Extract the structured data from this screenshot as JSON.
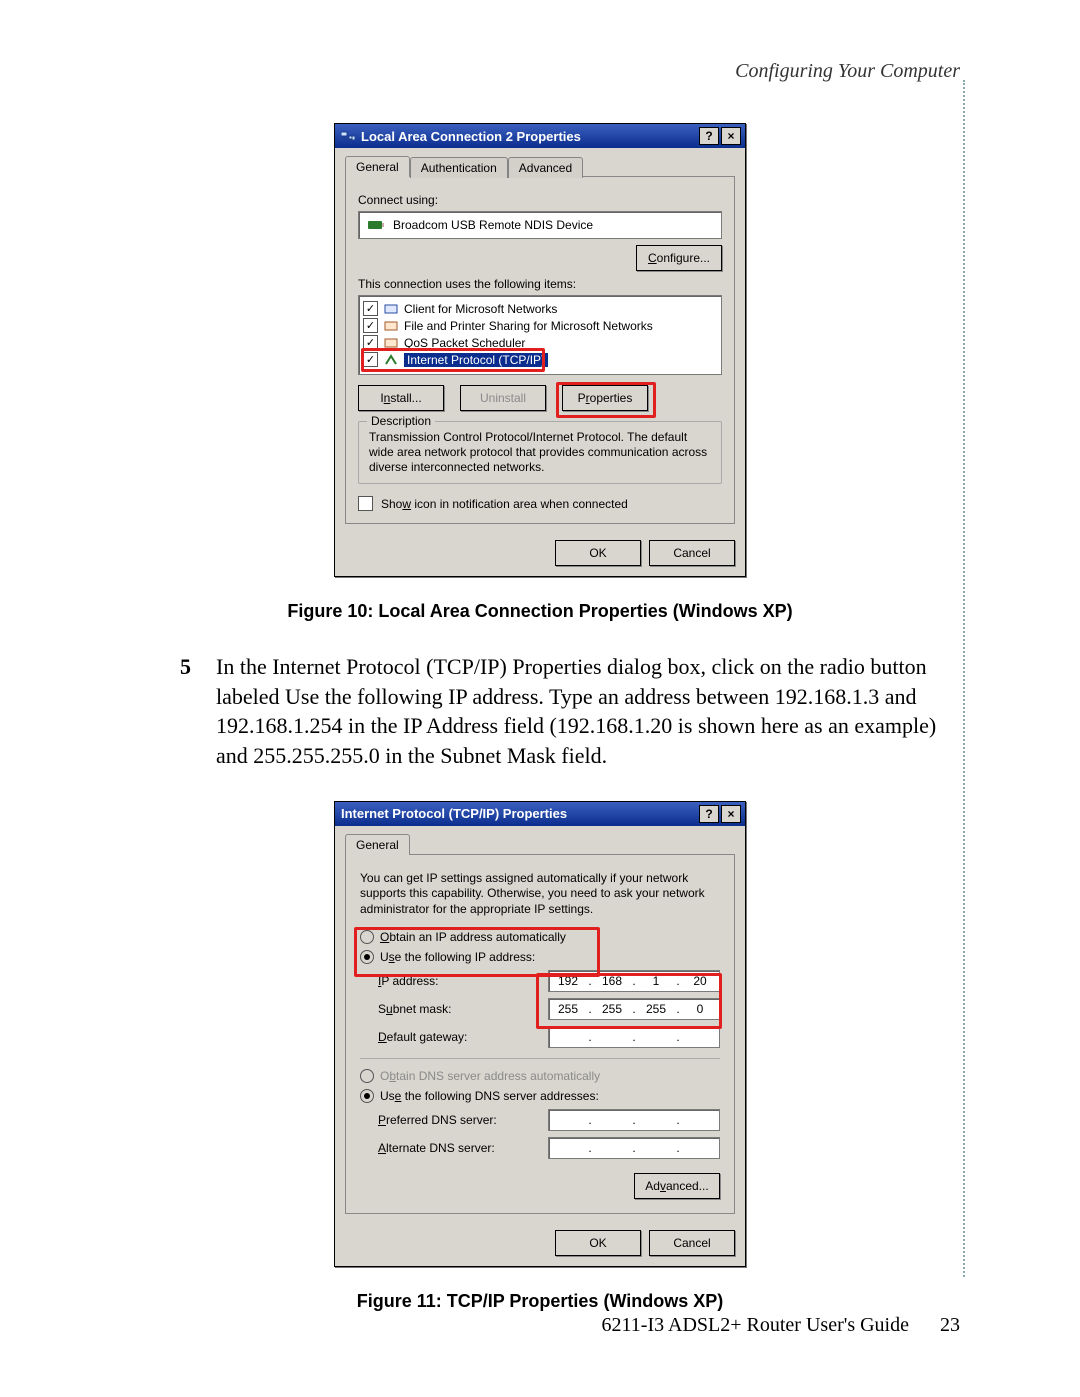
{
  "header": {
    "section": "Configuring Your Computer"
  },
  "figure1": {
    "title": "Local Area Connection 2 Properties",
    "tabs": [
      "General",
      "Authentication",
      "Advanced"
    ],
    "connect_using_label": "Connect using:",
    "device": "Broadcom USB Remote NDIS Device",
    "configure_btn": "Configure...",
    "items_label": "This connection uses the following items:",
    "items": [
      {
        "checked": true,
        "label": "Client for Microsoft Networks"
      },
      {
        "checked": true,
        "label": "File and Printer Sharing for Microsoft Networks"
      },
      {
        "checked": true,
        "label": "QoS Packet Scheduler"
      },
      {
        "checked": true,
        "label": "Internet Protocol (TCP/IP)",
        "selected": true
      }
    ],
    "install_btn": "Install...",
    "uninstall_btn": "Uninstall",
    "properties_btn": "Properties",
    "desc_label": "Description",
    "desc_text": "Transmission Control Protocol/Internet Protocol. The default wide area network protocol that provides communication across diverse interconnected networks.",
    "show_icon": "Show icon in notification area when connected",
    "ok": "OK",
    "cancel": "Cancel",
    "caption": "Figure 10: Local Area Connection Properties (Windows XP)"
  },
  "step5": {
    "num": "5",
    "text": "In the Internet Protocol (TCP/IP) Properties dialog box, click on the radio button labeled Use the following IP address. Type an address between 192.168.1.3 and 192.168.1.254 in the IP Address field (192.168.1.20 is shown here as an example) and 255.255.255.0 in the Subnet Mask field."
  },
  "figure2": {
    "title": "Internet Protocol (TCP/IP) Properties",
    "tab": "General",
    "info": "You can get IP settings assigned automatically if your network supports this capability. Otherwise, you need to ask your network administrator for the appropriate IP settings.",
    "radio_auto_ip": "Obtain an IP address automatically",
    "radio_use_ip": "Use the following IP address:",
    "ip_label": "IP address:",
    "ip_value": [
      "192",
      "168",
      "1",
      "20"
    ],
    "subnet_label": "Subnet mask:",
    "subnet_value": [
      "255",
      "255",
      "255",
      "0"
    ],
    "gateway_label": "Default gateway:",
    "gateway_value": [
      "",
      "",
      "",
      ""
    ],
    "radio_auto_dns": "Obtain DNS server address automatically",
    "radio_use_dns": "Use the following DNS server addresses:",
    "pref_dns_label": "Preferred DNS server:",
    "alt_dns_label": "Alternate DNS server:",
    "advanced_btn": "Advanced...",
    "ok": "OK",
    "cancel": "Cancel",
    "caption": "Figure 11: TCP/IP Properties (Windows XP)"
  },
  "footer": {
    "doc": "6211-I3 ADSL2+ Router User's Guide",
    "page": "23"
  }
}
